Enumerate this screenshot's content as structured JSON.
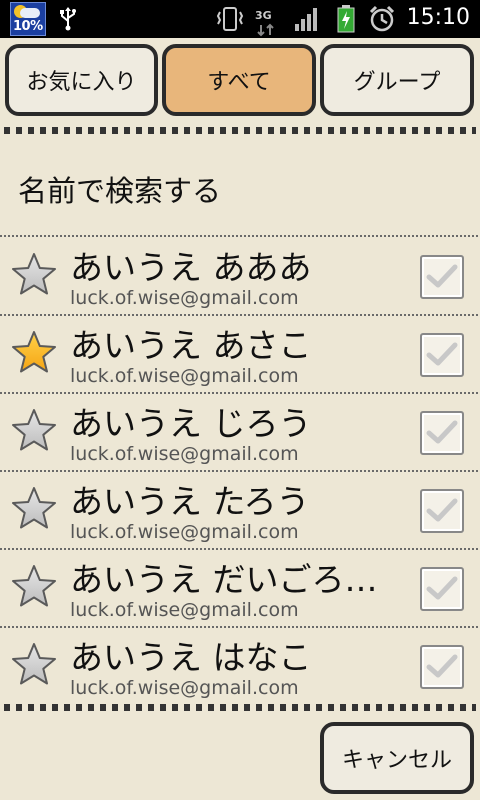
{
  "status_bar": {
    "weather_percent": "10%",
    "time": "15:10",
    "network": "3G",
    "icons": [
      "weather-icon",
      "usb-icon",
      "vibrate-icon",
      "network-3g-icon",
      "signal-icon",
      "battery-charging-icon",
      "alarm-icon"
    ]
  },
  "tabs": [
    {
      "label": "お気に入り",
      "active": false
    },
    {
      "label": "すべて",
      "active": true
    },
    {
      "label": "グループ",
      "active": false
    }
  ],
  "search": {
    "label": "名前で検索する"
  },
  "contacts": [
    {
      "name": "あいうえ あああ",
      "email": "luck.of.wise@gmail.com",
      "favorite": false
    },
    {
      "name": "あいうえ あさこ",
      "email": "luck.of.wise@gmail.com",
      "favorite": true
    },
    {
      "name": "あいうえ じろう",
      "email": "luck.of.wise@gmail.com",
      "favorite": false
    },
    {
      "name": "あいうえ たろう",
      "email": "luck.of.wise@gmail.com",
      "favorite": false
    },
    {
      "name": "あいうえ だいごろう…",
      "email": "luck.of.wise@gmail.com",
      "favorite": false
    },
    {
      "name": "あいうえ はなこ",
      "email": "luck.of.wise@gmail.com",
      "favorite": false
    }
  ],
  "footer": {
    "cancel_label": "キャンセル"
  },
  "colors": {
    "background": "#ede7d5",
    "active_tab": "#e8b67b",
    "favorite_star": "#f5a413",
    "inactive_star": "#bdbdbd"
  }
}
